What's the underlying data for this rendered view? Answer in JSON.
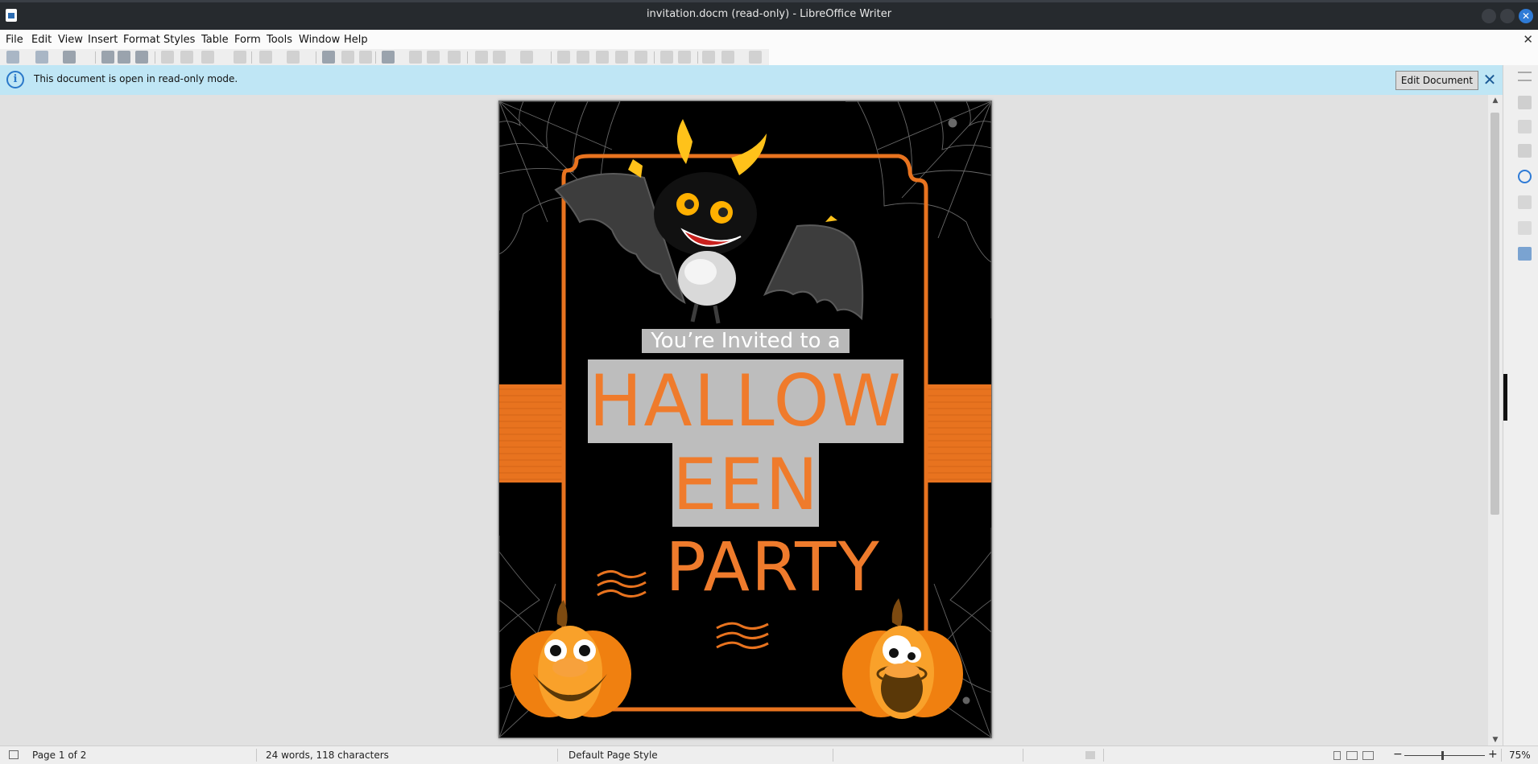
{
  "window": {
    "title": "invitation.docm (read-only) - LibreOffice Writer"
  },
  "menu": [
    "File",
    "Edit",
    "View",
    "Insert",
    "Format",
    "Styles",
    "Table",
    "Form",
    "Tools",
    "Window",
    "Help"
  ],
  "infobar": {
    "message": "This document is open in read-only mode.",
    "edit_button": "Edit Document",
    "close_symbol": "✕",
    "icon": "i"
  },
  "document": {
    "line1": "You’re Invited to a",
    "line2": "HALLOW",
    "line3": "EEN",
    "line4": "PARTY",
    "accent_color": "#ef7b2c",
    "highlight_color": "#bdbdbd"
  },
  "status": {
    "page": "Page 1 of 2",
    "words": "24 words, 118 characters",
    "page_style": "Default Page Style",
    "zoom": "75%",
    "zoom_out": "−",
    "zoom_in": "+"
  }
}
